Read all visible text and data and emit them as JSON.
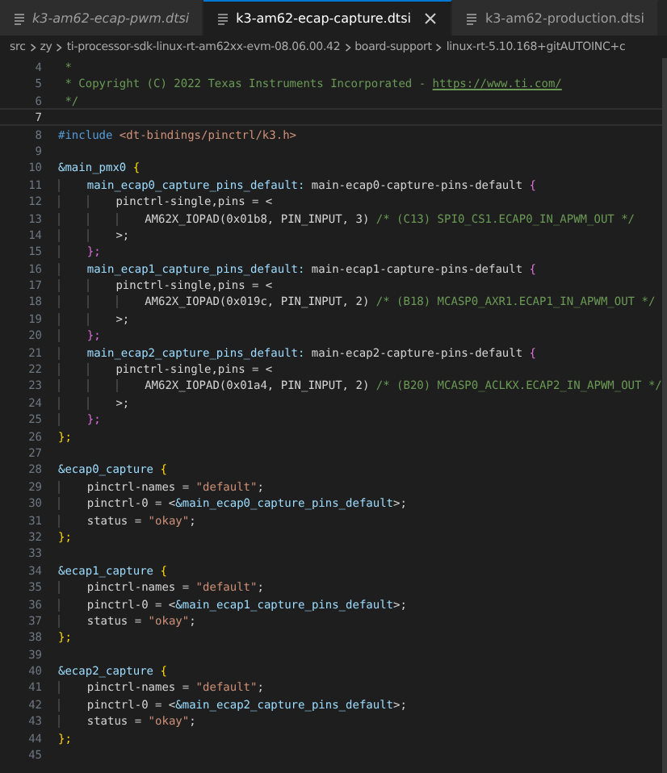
{
  "tabs": [
    {
      "label": "k3-am62-ecap-pwm.dtsi",
      "selected": false,
      "preview": true
    },
    {
      "label": "k3-am62-ecap-capture.dtsi",
      "selected": true,
      "preview": false
    },
    {
      "label": "k3-am62-production.dtsi",
      "selected": false,
      "preview": false
    }
  ],
  "breadcrumb": [
    "src",
    "zy",
    "ti-processor-sdk-linux-rt-am62xx-evm-08.06.00.42",
    "board-support",
    "linux-rt-5.10.168+gitAUTOINC+c"
  ],
  "lines": [
    {
      "number": "4",
      "current": false,
      "tokens": [
        {
          "text": " *",
          "kind": "comment"
        }
      ]
    },
    {
      "number": "5",
      "current": false,
      "tokens": [
        {
          "text": " * Copyright (C) 2022 Texas Instruments Incorporated - ",
          "kind": "comment"
        },
        {
          "text": "https://www.ti.com/",
          "kind": "link"
        }
      ]
    },
    {
      "number": "6",
      "current": false,
      "tokens": [
        {
          "text": " */",
          "kind": "comment"
        }
      ]
    },
    {
      "number": "7",
      "current": true
    },
    {
      "number": "8",
      "current": false,
      "tokens": [
        {
          "text": "#include",
          "kind": "keyword"
        },
        {
          "text": " <dt-bindings/pinctrl/k3.h>",
          "kind": "string"
        }
      ]
    },
    {
      "number": "9",
      "current": false
    },
    {
      "number": "10",
      "current": false,
      "tokens": [
        {
          "text": "&main_pmx0",
          "kind": "ref"
        },
        {
          "text": " {",
          "kind": "brace1"
        }
      ]
    },
    {
      "number": "11",
      "current": false,
      "tokens": [
        {
          "text": "    main_ecap0_capture_pins_default:",
          "kind": "ref"
        },
        {
          "text": " main-ecap0-capture-pins-default ",
          "kind": "plain"
        },
        {
          "text": "{",
          "kind": "brace2"
        }
      ]
    },
    {
      "number": "12",
      "current": false,
      "tokens": [
        {
          "text": "        pinctrl-single,pins = <",
          "kind": "plain"
        }
      ]
    },
    {
      "number": "13",
      "current": false,
      "tokens": [
        {
          "text": "            AM62X_IOPAD(0x01b8, PIN_INPUT, 3)",
          "kind": "plain"
        },
        {
          "text": " /* (C13) SPI0_CS1.ECAP0_IN_APWM_OUT */",
          "kind": "comment"
        }
      ]
    },
    {
      "number": "14",
      "current": false,
      "tokens": [
        {
          "text": "        >;",
          "kind": "plain"
        }
      ]
    },
    {
      "number": "15",
      "current": false,
      "tokens": [
        {
          "text": "    };",
          "kind": "brace2"
        }
      ]
    },
    {
      "number": "16",
      "current": false,
      "tokens": [
        {
          "text": "    main_ecap1_capture_pins_default:",
          "kind": "ref"
        },
        {
          "text": " main-ecap1-capture-pins-default ",
          "kind": "plain"
        },
        {
          "text": "{",
          "kind": "brace2"
        }
      ]
    },
    {
      "number": "17",
      "current": false,
      "tokens": [
        {
          "text": "        pinctrl-single,pins = <",
          "kind": "plain"
        }
      ]
    },
    {
      "number": "18",
      "current": false,
      "tokens": [
        {
          "text": "            AM62X_IOPAD(0x019c, PIN_INPUT, 2)",
          "kind": "plain"
        },
        {
          "text": " /* (B18) MCASP0_AXR1.ECAP1_IN_APWM_OUT */",
          "kind": "comment"
        }
      ]
    },
    {
      "number": "19",
      "current": false,
      "tokens": [
        {
          "text": "        >;",
          "kind": "plain"
        }
      ]
    },
    {
      "number": "20",
      "current": false,
      "tokens": [
        {
          "text": "    };",
          "kind": "brace2"
        }
      ]
    },
    {
      "number": "21",
      "current": false,
      "tokens": [
        {
          "text": "    main_ecap2_capture_pins_default:",
          "kind": "ref"
        },
        {
          "text": " main-ecap2-capture-pins-default ",
          "kind": "plain"
        },
        {
          "text": "{",
          "kind": "brace2"
        }
      ]
    },
    {
      "number": "22",
      "current": false,
      "tokens": [
        {
          "text": "        pinctrl-single,pins = <",
          "kind": "plain"
        }
      ]
    },
    {
      "number": "23",
      "current": false,
      "tokens": [
        {
          "text": "            AM62X_IOPAD(0x01a4, PIN_INPUT, 2)",
          "kind": "plain"
        },
        {
          "text": " /* (B20) MCASP0_ACLKX.ECAP2_IN_APWM_OUT */",
          "kind": "comment"
        }
      ]
    },
    {
      "number": "24",
      "current": false,
      "tokens": [
        {
          "text": "        >;",
          "kind": "plain"
        }
      ]
    },
    {
      "number": "25",
      "current": false,
      "tokens": [
        {
          "text": "    };",
          "kind": "brace2"
        }
      ]
    },
    {
      "number": "26",
      "current": false,
      "tokens": [
        {
          "text": "};",
          "kind": "brace1"
        }
      ]
    },
    {
      "number": "27",
      "current": false
    },
    {
      "number": "28",
      "current": false,
      "tokens": [
        {
          "text": "&ecap0_capture",
          "kind": "ref"
        },
        {
          "text": " {",
          "kind": "brace1"
        }
      ]
    },
    {
      "number": "29",
      "current": false,
      "tokens": [
        {
          "text": "    pinctrl-names = ",
          "kind": "plain"
        },
        {
          "text": "\"default\"",
          "kind": "string"
        },
        {
          "text": ";",
          "kind": "plain"
        }
      ]
    },
    {
      "number": "30",
      "current": false,
      "tokens": [
        {
          "text": "    pinctrl-0 = <",
          "kind": "plain"
        },
        {
          "text": "&main_ecap0_capture_pins_default",
          "kind": "ref"
        },
        {
          "text": ">;",
          "kind": "plain"
        }
      ]
    },
    {
      "number": "31",
      "current": false,
      "tokens": [
        {
          "text": "    status = ",
          "kind": "plain"
        },
        {
          "text": "\"okay\"",
          "kind": "string"
        },
        {
          "text": ";",
          "kind": "plain"
        }
      ]
    },
    {
      "number": "32",
      "current": false,
      "tokens": [
        {
          "text": "};",
          "kind": "brace1"
        }
      ]
    },
    {
      "number": "33",
      "current": false
    },
    {
      "number": "34",
      "current": false,
      "tokens": [
        {
          "text": "&ecap1_capture",
          "kind": "ref"
        },
        {
          "text": " {",
          "kind": "brace1"
        }
      ]
    },
    {
      "number": "35",
      "current": false,
      "tokens": [
        {
          "text": "    pinctrl-names = ",
          "kind": "plain"
        },
        {
          "text": "\"default\"",
          "kind": "string"
        },
        {
          "text": ";",
          "kind": "plain"
        }
      ]
    },
    {
      "number": "36",
      "current": false,
      "tokens": [
        {
          "text": "    pinctrl-0 = <",
          "kind": "plain"
        },
        {
          "text": "&main_ecap1_capture_pins_default",
          "kind": "ref"
        },
        {
          "text": ">;",
          "kind": "plain"
        }
      ]
    },
    {
      "number": "37",
      "current": false,
      "tokens": [
        {
          "text": "    status = ",
          "kind": "plain"
        },
        {
          "text": "\"okay\"",
          "kind": "string"
        },
        {
          "text": ";",
          "kind": "plain"
        }
      ]
    },
    {
      "number": "38",
      "current": false,
      "tokens": [
        {
          "text": "};",
          "kind": "brace1"
        }
      ]
    },
    {
      "number": "39",
      "current": false
    },
    {
      "number": "40",
      "current": false,
      "tokens": [
        {
          "text": "&ecap2_capture",
          "kind": "ref"
        },
        {
          "text": " {",
          "kind": "brace1"
        }
      ]
    },
    {
      "number": "41",
      "current": false,
      "tokens": [
        {
          "text": "    pinctrl-names = ",
          "kind": "plain"
        },
        {
          "text": "\"default\"",
          "kind": "string"
        },
        {
          "text": ";",
          "kind": "plain"
        }
      ]
    },
    {
      "number": "42",
      "current": false,
      "tokens": [
        {
          "text": "    pinctrl-0 = <",
          "kind": "plain"
        },
        {
          "text": "&main_ecap2_capture_pins_default",
          "kind": "ref"
        },
        {
          "text": ">;",
          "kind": "plain"
        }
      ]
    },
    {
      "number": "43",
      "current": false,
      "tokens": [
        {
          "text": "    status = ",
          "kind": "plain"
        },
        {
          "text": "\"okay\"",
          "kind": "string"
        },
        {
          "text": ";",
          "kind": "plain"
        }
      ]
    },
    {
      "number": "44",
      "current": false,
      "tokens": [
        {
          "text": "};",
          "kind": "brace1"
        }
      ]
    },
    {
      "number": "45",
      "current": false
    }
  ]
}
